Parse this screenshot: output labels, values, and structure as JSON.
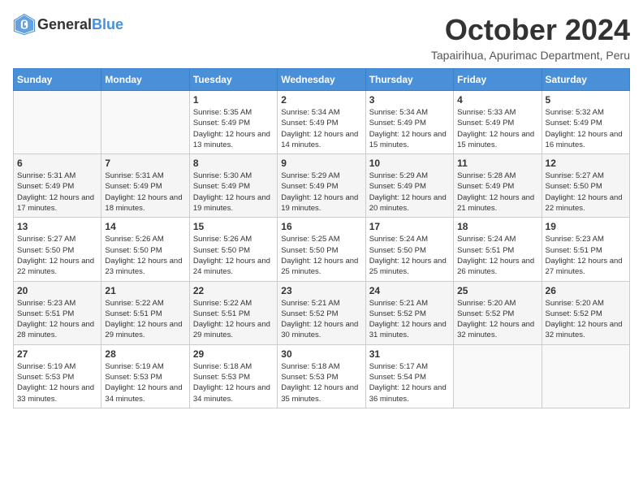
{
  "logo": {
    "general": "General",
    "blue": "Blue"
  },
  "header": {
    "month": "October 2024",
    "subtitle": "Tapairihua, Apurimac Department, Peru"
  },
  "weekdays": [
    "Sunday",
    "Monday",
    "Tuesday",
    "Wednesday",
    "Thursday",
    "Friday",
    "Saturday"
  ],
  "weeks": [
    [
      {
        "day": "",
        "info": ""
      },
      {
        "day": "",
        "info": ""
      },
      {
        "day": "1",
        "info": "Sunrise: 5:35 AM\nSunset: 5:49 PM\nDaylight: 12 hours and 13 minutes."
      },
      {
        "day": "2",
        "info": "Sunrise: 5:34 AM\nSunset: 5:49 PM\nDaylight: 12 hours and 14 minutes."
      },
      {
        "day": "3",
        "info": "Sunrise: 5:34 AM\nSunset: 5:49 PM\nDaylight: 12 hours and 15 minutes."
      },
      {
        "day": "4",
        "info": "Sunrise: 5:33 AM\nSunset: 5:49 PM\nDaylight: 12 hours and 15 minutes."
      },
      {
        "day": "5",
        "info": "Sunrise: 5:32 AM\nSunset: 5:49 PM\nDaylight: 12 hours and 16 minutes."
      }
    ],
    [
      {
        "day": "6",
        "info": "Sunrise: 5:31 AM\nSunset: 5:49 PM\nDaylight: 12 hours and 17 minutes."
      },
      {
        "day": "7",
        "info": "Sunrise: 5:31 AM\nSunset: 5:49 PM\nDaylight: 12 hours and 18 minutes."
      },
      {
        "day": "8",
        "info": "Sunrise: 5:30 AM\nSunset: 5:49 PM\nDaylight: 12 hours and 19 minutes."
      },
      {
        "day": "9",
        "info": "Sunrise: 5:29 AM\nSunset: 5:49 PM\nDaylight: 12 hours and 19 minutes."
      },
      {
        "day": "10",
        "info": "Sunrise: 5:29 AM\nSunset: 5:49 PM\nDaylight: 12 hours and 20 minutes."
      },
      {
        "day": "11",
        "info": "Sunrise: 5:28 AM\nSunset: 5:49 PM\nDaylight: 12 hours and 21 minutes."
      },
      {
        "day": "12",
        "info": "Sunrise: 5:27 AM\nSunset: 5:50 PM\nDaylight: 12 hours and 22 minutes."
      }
    ],
    [
      {
        "day": "13",
        "info": "Sunrise: 5:27 AM\nSunset: 5:50 PM\nDaylight: 12 hours and 22 minutes."
      },
      {
        "day": "14",
        "info": "Sunrise: 5:26 AM\nSunset: 5:50 PM\nDaylight: 12 hours and 23 minutes."
      },
      {
        "day": "15",
        "info": "Sunrise: 5:26 AM\nSunset: 5:50 PM\nDaylight: 12 hours and 24 minutes."
      },
      {
        "day": "16",
        "info": "Sunrise: 5:25 AM\nSunset: 5:50 PM\nDaylight: 12 hours and 25 minutes."
      },
      {
        "day": "17",
        "info": "Sunrise: 5:24 AM\nSunset: 5:50 PM\nDaylight: 12 hours and 25 minutes."
      },
      {
        "day": "18",
        "info": "Sunrise: 5:24 AM\nSunset: 5:51 PM\nDaylight: 12 hours and 26 minutes."
      },
      {
        "day": "19",
        "info": "Sunrise: 5:23 AM\nSunset: 5:51 PM\nDaylight: 12 hours and 27 minutes."
      }
    ],
    [
      {
        "day": "20",
        "info": "Sunrise: 5:23 AM\nSunset: 5:51 PM\nDaylight: 12 hours and 28 minutes."
      },
      {
        "day": "21",
        "info": "Sunrise: 5:22 AM\nSunset: 5:51 PM\nDaylight: 12 hours and 29 minutes."
      },
      {
        "day": "22",
        "info": "Sunrise: 5:22 AM\nSunset: 5:51 PM\nDaylight: 12 hours and 29 minutes."
      },
      {
        "day": "23",
        "info": "Sunrise: 5:21 AM\nSunset: 5:52 PM\nDaylight: 12 hours and 30 minutes."
      },
      {
        "day": "24",
        "info": "Sunrise: 5:21 AM\nSunset: 5:52 PM\nDaylight: 12 hours and 31 minutes."
      },
      {
        "day": "25",
        "info": "Sunrise: 5:20 AM\nSunset: 5:52 PM\nDaylight: 12 hours and 32 minutes."
      },
      {
        "day": "26",
        "info": "Sunrise: 5:20 AM\nSunset: 5:52 PM\nDaylight: 12 hours and 32 minutes."
      }
    ],
    [
      {
        "day": "27",
        "info": "Sunrise: 5:19 AM\nSunset: 5:53 PM\nDaylight: 12 hours and 33 minutes."
      },
      {
        "day": "28",
        "info": "Sunrise: 5:19 AM\nSunset: 5:53 PM\nDaylight: 12 hours and 34 minutes."
      },
      {
        "day": "29",
        "info": "Sunrise: 5:18 AM\nSunset: 5:53 PM\nDaylight: 12 hours and 34 minutes."
      },
      {
        "day": "30",
        "info": "Sunrise: 5:18 AM\nSunset: 5:53 PM\nDaylight: 12 hours and 35 minutes."
      },
      {
        "day": "31",
        "info": "Sunrise: 5:17 AM\nSunset: 5:54 PM\nDaylight: 12 hours and 36 minutes."
      },
      {
        "day": "",
        "info": ""
      },
      {
        "day": "",
        "info": ""
      }
    ]
  ]
}
